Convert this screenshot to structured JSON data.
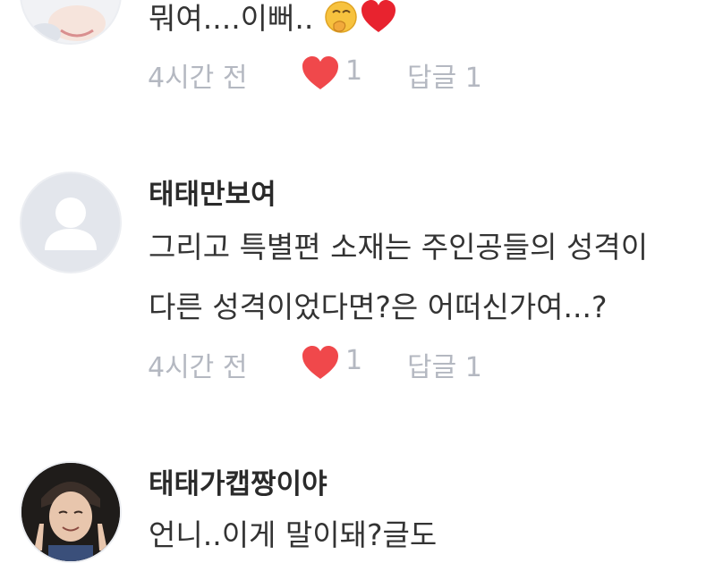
{
  "comments": [
    {
      "username": "",
      "lines": [
        "뭐여....이뻐.."
      ],
      "emojis": [
        "face-with-hand-over-mouth-emoji",
        "red-heart-emoji"
      ],
      "time": "4시간 전",
      "likes": "1",
      "reply_label": "답글 1"
    },
    {
      "username": "태태만보여",
      "lines": [
        "그리고 특별편 소재는 주인공들의 성격이",
        "다른 성격이었다면?은 어떠신가여...?"
      ],
      "time": "4시간 전",
      "likes": "1",
      "reply_label": "답글 1"
    },
    {
      "username": "태태가캡짱이야",
      "lines": [
        "언니..이게 말이돼?글도"
      ]
    }
  ],
  "colors": {
    "heart": "#f0484b",
    "meta_text": "#b4b8c1",
    "default_avatar_bg": "#e3e6ec"
  }
}
